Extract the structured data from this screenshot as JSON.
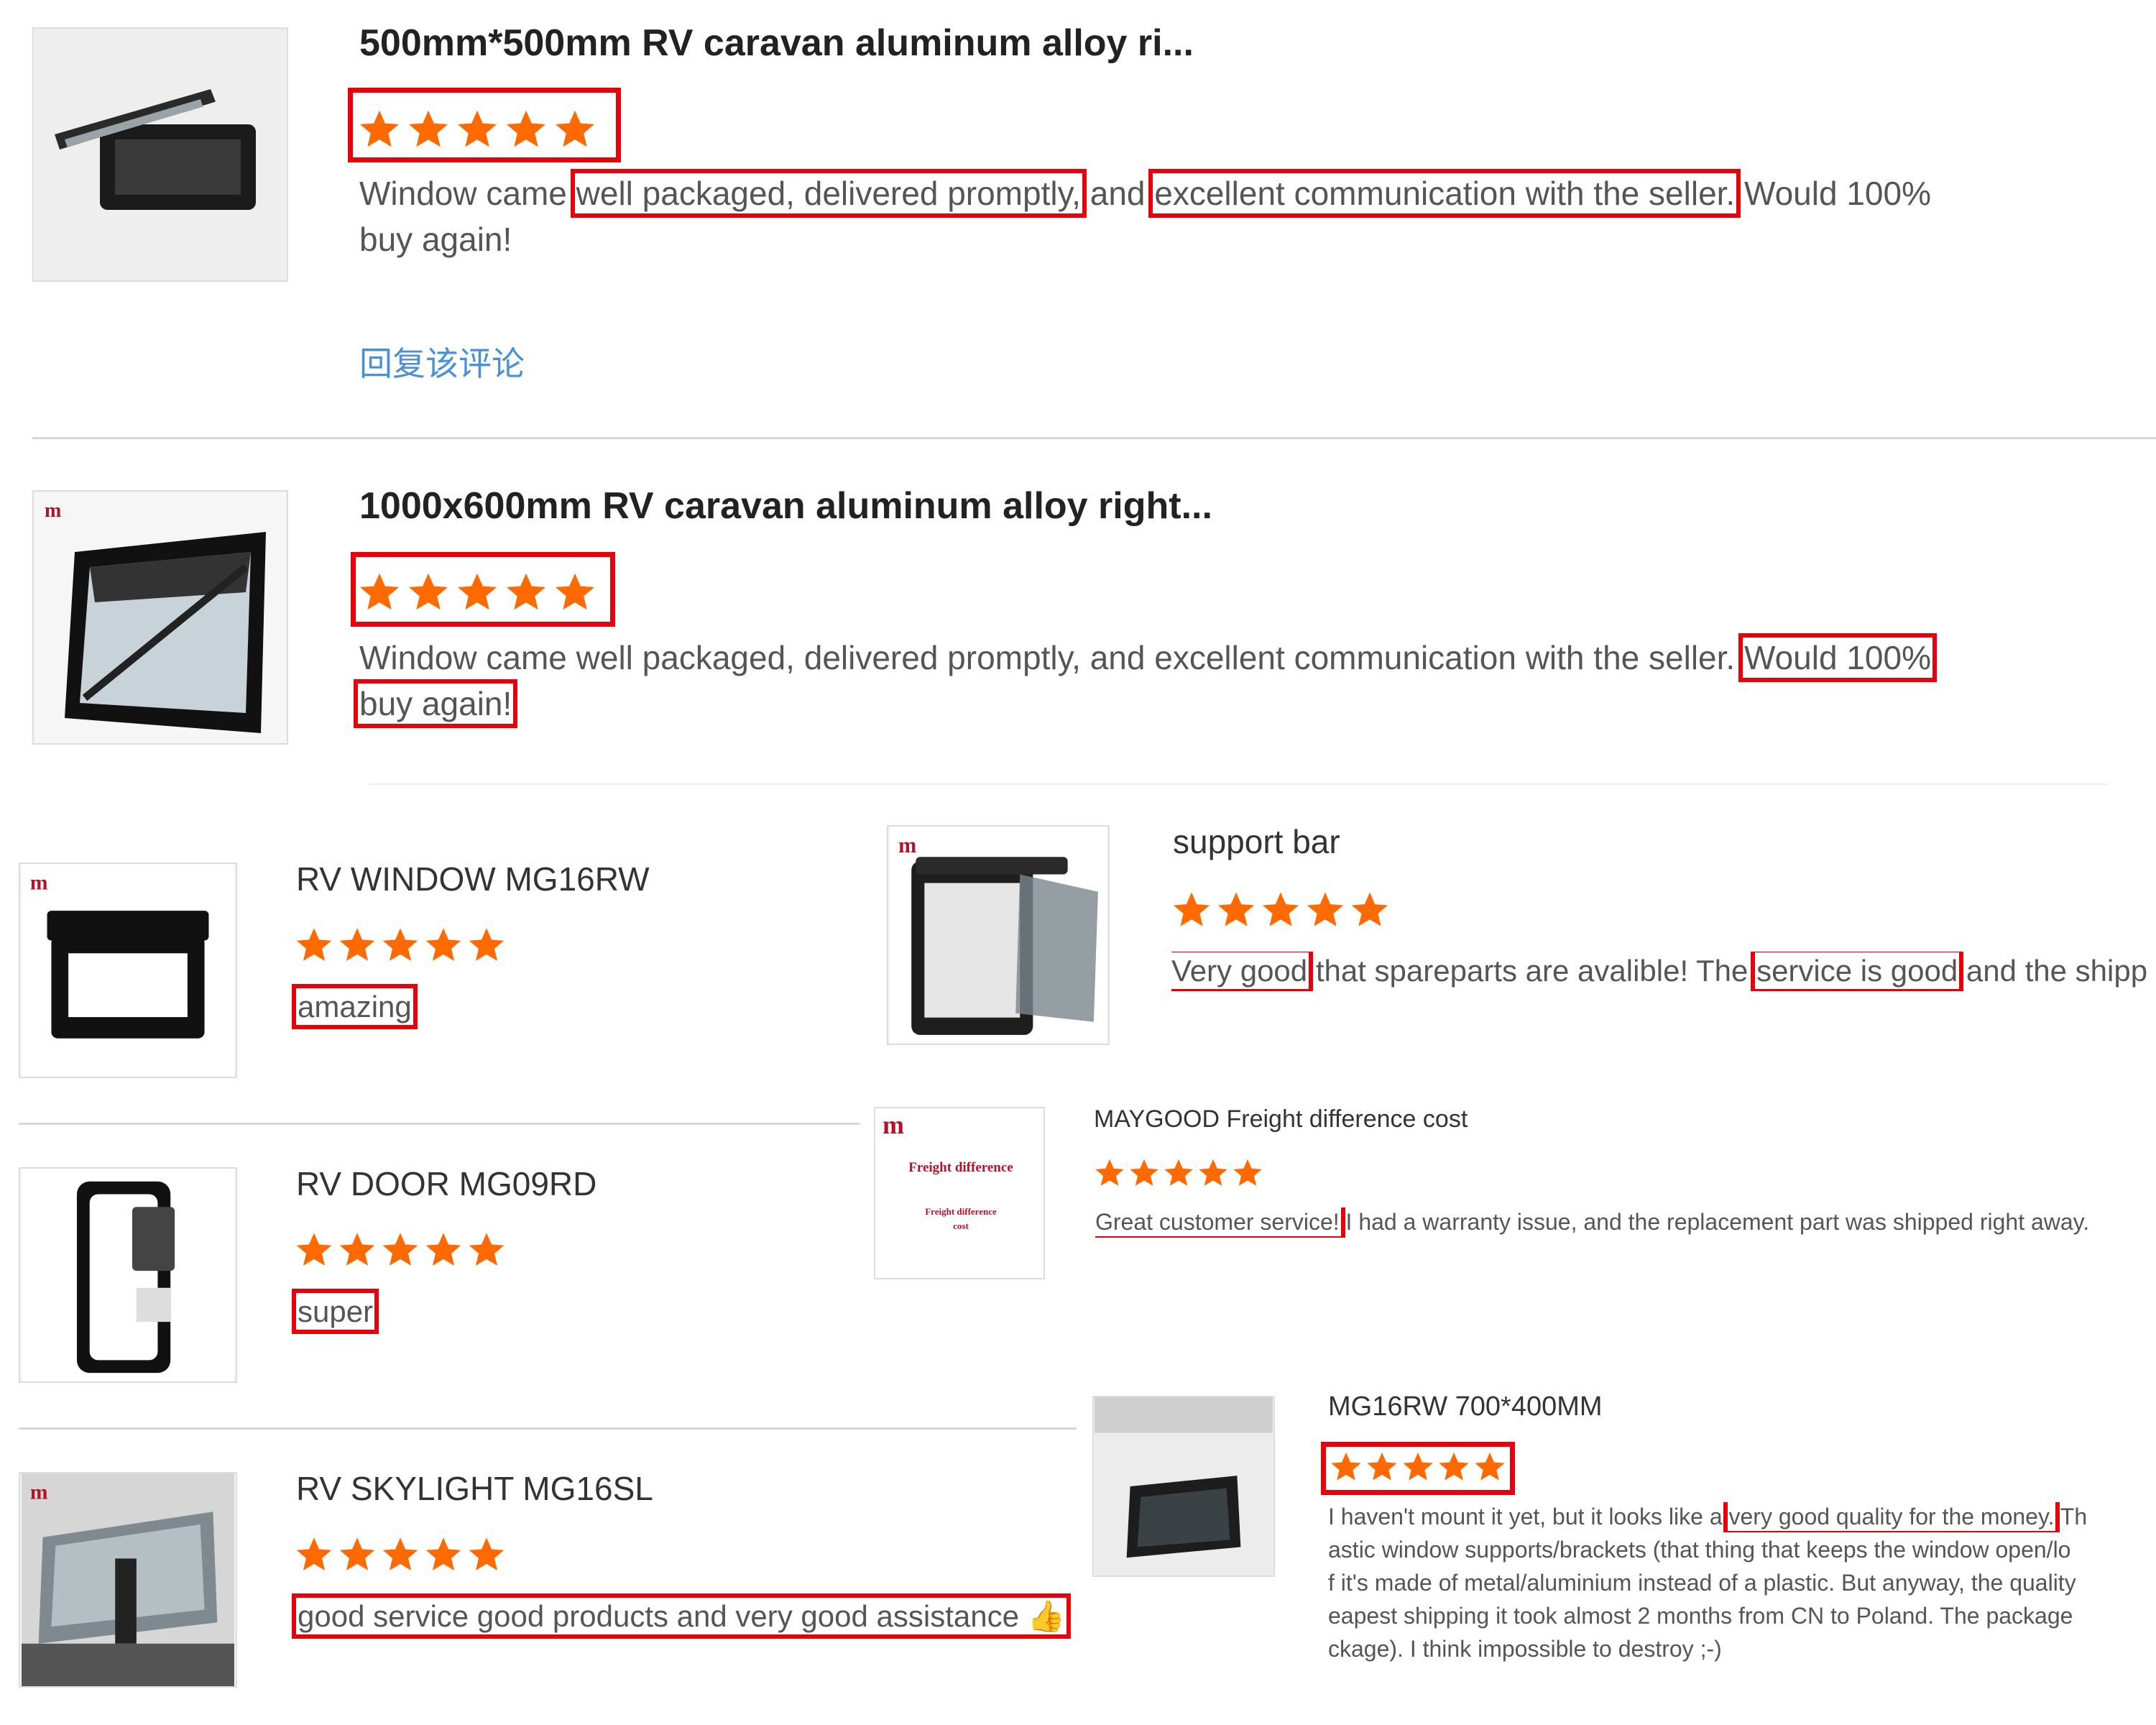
{
  "reviews": [
    {
      "title": "500mm*500mm RV caravan aluminum alloy ri...",
      "rating": 5,
      "text_before": "Window came ",
      "hl1": "well packaged, delivered promptly,",
      "text_mid": " and ",
      "hl2": "excellent communication with the seller.",
      "text_after": " Would 100%",
      "line2": "buy again!",
      "reply": "回复该评论"
    },
    {
      "title": "1000x600mm RV caravan aluminum alloy right...",
      "rating": 5,
      "text_line1": "Window came well packaged, delivered promptly, and excellent communication with the seller.",
      "hl_line1": "Would 100%",
      "hl_line2": "buy again!"
    },
    {
      "title": "RV WINDOW MG16RW",
      "rating": 5,
      "hl": "amazing"
    },
    {
      "title": "support bar",
      "rating": 5,
      "hl1": "Very good",
      "text_mid": " that spareparts are avalible! The ",
      "hl2": "service is good",
      "text_after": " and the shipp"
    },
    {
      "title": "MAYGOOD Freight difference cost",
      "rating": 5,
      "hl": "Great customer service!",
      "text_after": " I had a warranty issue, and the replacement part was shipped right away.",
      "thumb_text1": "Freight difference",
      "thumb_text2": "Freight difference",
      "thumb_text3": "cost"
    },
    {
      "title": "RV DOOR MG09RD",
      "rating": 5,
      "hl": "super"
    },
    {
      "title": "MG16RW 700*400MM",
      "rating": 5,
      "text_before": "I haven't mount it yet, but it looks like a ",
      "hl": "very good quality for the money.",
      "text_after": " Th",
      "line2": "astic window supports/brackets (that thing that keeps the window open/lo",
      "line3": "f it's made of metal/aluminium instead of a plastic. But anyway, the quality",
      "line4": "eapest shipping it took almost 2 months from CN to Poland. The package",
      "line5": "ckage). I think impossible to destroy ;-)"
    },
    {
      "title": "RV SKYLIGHT MG16SL",
      "rating": 5,
      "hl": "good service good products and very good assistance 👍"
    }
  ],
  "colors": {
    "star": "#ff6a00",
    "highlight": "#e8000b",
    "reply": "#4a90d9"
  },
  "brand_mark": "m"
}
